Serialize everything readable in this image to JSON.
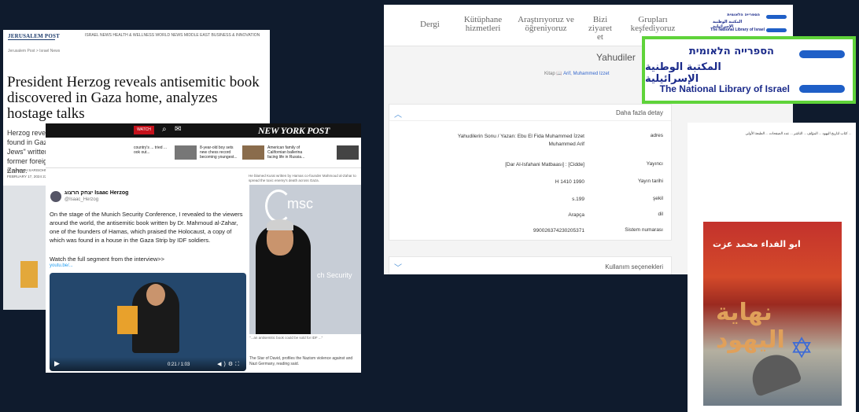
{
  "jpost": {
    "masthead": "JERUSALEM POST",
    "nav": "ISRAEL NEWS   HEALTH & WELLNESS   WORLD NEWS   MIDDLE EAST   BUSINESS & INNOVATION",
    "crumb": "Jerusalem Post > Israel News",
    "headline": "President Herzog reveals antisemitic book discovered in Gaza home, analyzes hostage talks",
    "lead": "Herzog revealed a book that IDF soldiers found in Gaza called \"The End of the Jews\" written by Hamas co-founder and former foreign minister Mahmoud al-Zahar.",
    "byline1": "By HANNAH SARISOHN",
    "byline2": "FEBRUARY 17, 2024 22:41   Updated: FEBRUARY 18, 2024 00:..."
  },
  "nypost": {
    "logo": "NEW YORK POST",
    "red_label": "WATCH",
    "strip": [
      "country's ... tried ... ook out...",
      "8-year-old boy sets new chess record becoming youngest...",
      "American family of Californian ballerina facing life in Russia..."
    ],
    "caption_top": "He blamed Kurat written by Hamas co-founder Mahmoud al-Zahar to spread the toxic enemy's death across Gaza.",
    "tweet": {
      "name": "יצחק הרצוג Isaac Herzog",
      "handle": "@Isaac_Herzog",
      "body": "On the stage of the Munich Security Conference, I revealed to the viewers around the world, the antisemitic book written by Dr. Mahmoud al-Zahar, one of the founders of Hamas, which praised the Holocaust, a copy of which was found in a house in the Gaza Strip by IDF soldiers.",
      "watch": "Watch the full segment from the interview>>",
      "link": "youtu.be/..."
    },
    "video_time": "0:21 / 1:03",
    "photo_msc": "msc",
    "photo_sec": "ch Security",
    "photo_caption": "\"...an antisemitic book could be sold for IDF ...\"",
    "photo_body": "The Star of David, profiles the Nazism violence against and Nazi Germany, reading said."
  },
  "nli": {
    "nav": [
      "Dergi",
      "Kütüphane hizmetleri",
      "Araştırıyoruz ve öğreniyoruz",
      "Bizi ziyaret et",
      "Grupları keşfediyoruz"
    ],
    "small_logo_heb": "הספרייה הלאומית",
    "small_logo_arb": "المكتبة الوطنية الإسرائيلية",
    "small_logo_eng": "The National Library of Israel",
    "title": "Yahudiler",
    "meta_label": "Kitap",
    "meta_author": "Arif, Muhammed Izzet",
    "details_title": "Daha fazla detay",
    "rows": [
      {
        "k": "adres",
        "v": "Yahudilerin Sonu / Yazan: Ebu El Fida Muhammed İzzet Muhammed Arif"
      },
      {
        "k": "Yayıncı",
        "v": "[Dar Al-Isfahani Matbaası] : [Cidde]"
      },
      {
        "k": "Yayın tarihi",
        "v": "H 1410 1990"
      },
      {
        "k": "şekil",
        "v": "s.199"
      },
      {
        "k": "dil",
        "v": "Arapça"
      },
      {
        "k": "Sistem numarası",
        "v": "990026374230205371"
      }
    ],
    "usage_title": "Kullanım seçenekleri"
  },
  "big_logo": {
    "heb": "הספרייה הלאומית",
    "arb": "المكتبة الوطنية الإسرائيلية",
    "eng": "The National Library of Israel"
  },
  "book": {
    "text": "كتاب لتاريخ اليهود ... المؤلف ... الناشر ... عدد الصفحات ... الطبعة الأولى ...",
    "cover_top": "ابو الفداء محمد عزت",
    "cover_title": "نهاية اليهود"
  }
}
